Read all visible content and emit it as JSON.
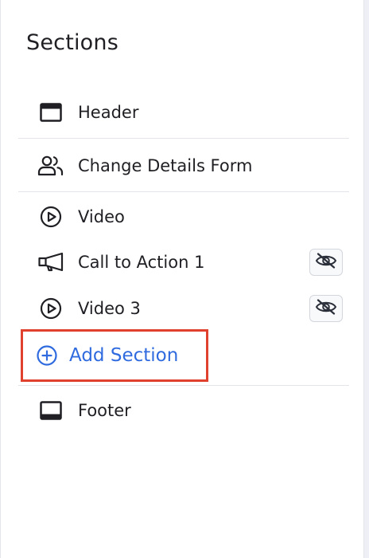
{
  "panel": {
    "title": "Sections",
    "sections": [
      {
        "label": "Header",
        "icon": "header-layout-icon"
      },
      {
        "label": "Change Details Form",
        "icon": "users-icon"
      },
      {
        "label": "Video",
        "icon": "play-circle-icon"
      },
      {
        "label": "Call to Action 1",
        "icon": "megaphone-icon",
        "hidden": true
      },
      {
        "label": "Video 3",
        "icon": "play-circle-icon",
        "hidden": true
      },
      {
        "label": "Footer",
        "icon": "footer-layout-icon"
      }
    ],
    "add_section_label": "Add Section",
    "colors": {
      "accent": "#2f6bdf",
      "highlight_border": "#e0412e",
      "divider": "#e3e5ea"
    }
  }
}
